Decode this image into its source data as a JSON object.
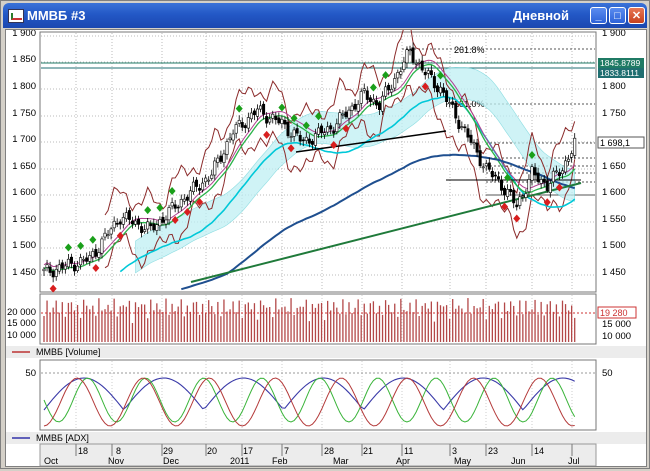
{
  "window": {
    "title": "ММВБ #3",
    "period": "Дневной",
    "min_symbol": "_",
    "max_symbol": "□",
    "close_symbol": "✕"
  },
  "price_panel": {
    "left_ticks": [
      "1 900",
      "1 850",
      "1 800",
      "1 750",
      "1 700",
      "1 650",
      "1 600",
      "1 550",
      "1 500",
      "1 450"
    ],
    "right_ticks": [
      "1 900",
      "1 800",
      "1 750",
      "1 650",
      "1 600",
      "1 550",
      "1 500",
      "1 450"
    ],
    "price_labels": [
      "1845.8789",
      "1833.8111",
      "1 698,1"
    ],
    "fib_labels": [
      "261.8%",
      "161.0%"
    ]
  },
  "volume_panel": {
    "left_ticks": [
      "20 000",
      "15 000",
      "10 000"
    ],
    "right_ticks": [
      "19 280",
      "15 000",
      "10 000"
    ],
    "legend": "ММВБ [Volume]"
  },
  "adx_panel": {
    "left_tick": "50",
    "right_tick": "50",
    "legend": "ММВБ [ADX]"
  },
  "time_axis": {
    "days": [
      "18",
      "8",
      "29",
      "20",
      "17",
      "7",
      "28",
      "21",
      "11",
      "3",
      "23",
      "14"
    ],
    "months": [
      "Oct",
      "Nov",
      "Dec",
      "2011",
      "Feb",
      "Mar",
      "Apr",
      "May",
      "Jun",
      "Jul"
    ]
  },
  "colors": {
    "titlebar": "#245edb",
    "bull": "#1a9f1a",
    "bear": "#d81e1e",
    "cyan": "#00c8d8",
    "navy": "#1f4f8f",
    "trend": "#1f7a3a",
    "brown": "#8b2a2a"
  }
}
